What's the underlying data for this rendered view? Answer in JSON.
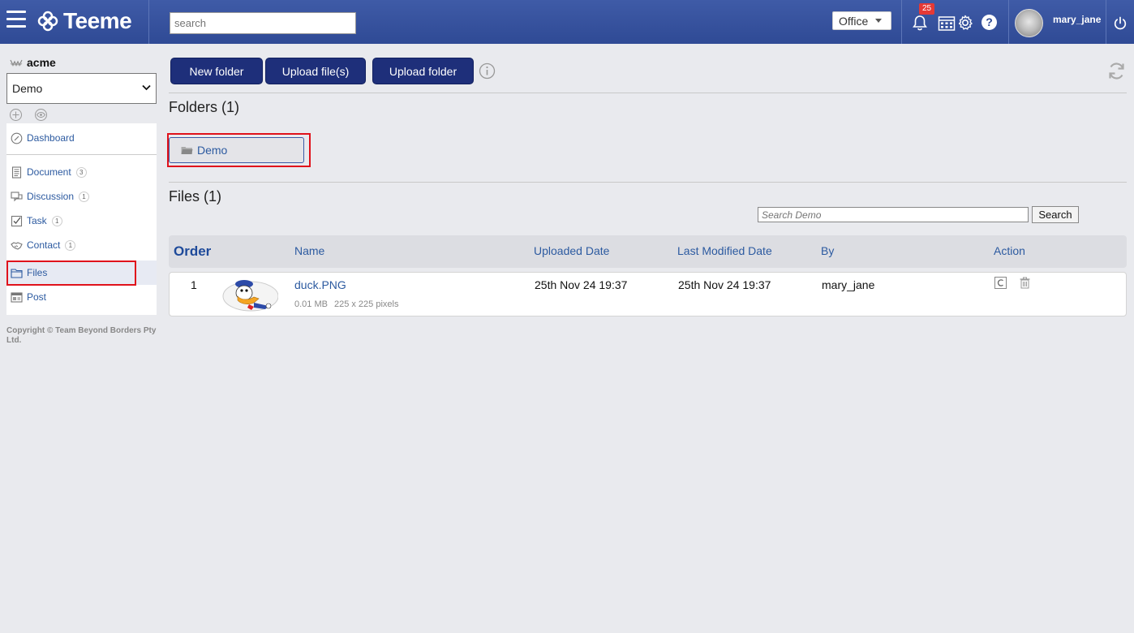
{
  "app": {
    "name": "Teeme"
  },
  "header": {
    "search_placeholder": "search",
    "office_label": "Office",
    "notification_count": "25",
    "help_label": "?",
    "username": "mary_jane"
  },
  "sidebar": {
    "org_name": "acme",
    "workspace_selected": "Demo",
    "items": [
      {
        "label": "Dashboard",
        "icon": "compass-icon",
        "count": ""
      },
      {
        "label": "Document",
        "icon": "document-icon",
        "count": "3"
      },
      {
        "label": "Discussion",
        "icon": "discussion-icon",
        "count": "1"
      },
      {
        "label": "Task",
        "icon": "checkbox-icon",
        "count": "1"
      },
      {
        "label": "Contact",
        "icon": "handshake-icon",
        "count": "1"
      },
      {
        "label": "Files",
        "icon": "folder-icon",
        "count": ""
      },
      {
        "label": "Post",
        "icon": "post-icon",
        "count": ""
      }
    ],
    "copyright": "Copyright © Team Beyond Borders Pty Ltd."
  },
  "toolbar": {
    "new_folder": "New folder",
    "upload_files": "Upload file(s)",
    "upload_folder": "Upload folder"
  },
  "folders": {
    "title": "Folders (1)",
    "items": [
      {
        "name": "Demo"
      }
    ]
  },
  "files": {
    "title": "Files (1)",
    "search_placeholder": "Search Demo",
    "search_button": "Search",
    "columns": {
      "order": "Order",
      "name": "Name",
      "uploaded": "Uploaded Date",
      "modified": "Last Modified Date",
      "by": "By",
      "action": "Action"
    },
    "rows": [
      {
        "order": "1",
        "name": "duck.PNG",
        "size": "0.01 MB",
        "dimensions": "225 x 225 pixels",
        "uploaded": "25th Nov 24 19:37",
        "modified": "25th Nov 24 19:37",
        "by": "mary_jane"
      }
    ]
  },
  "colors": {
    "header_bg": "#2f4a95",
    "primary_button": "#1e2f7a",
    "link": "#2c5aa0",
    "highlight": "#e0121b",
    "badge": "#e53935"
  }
}
